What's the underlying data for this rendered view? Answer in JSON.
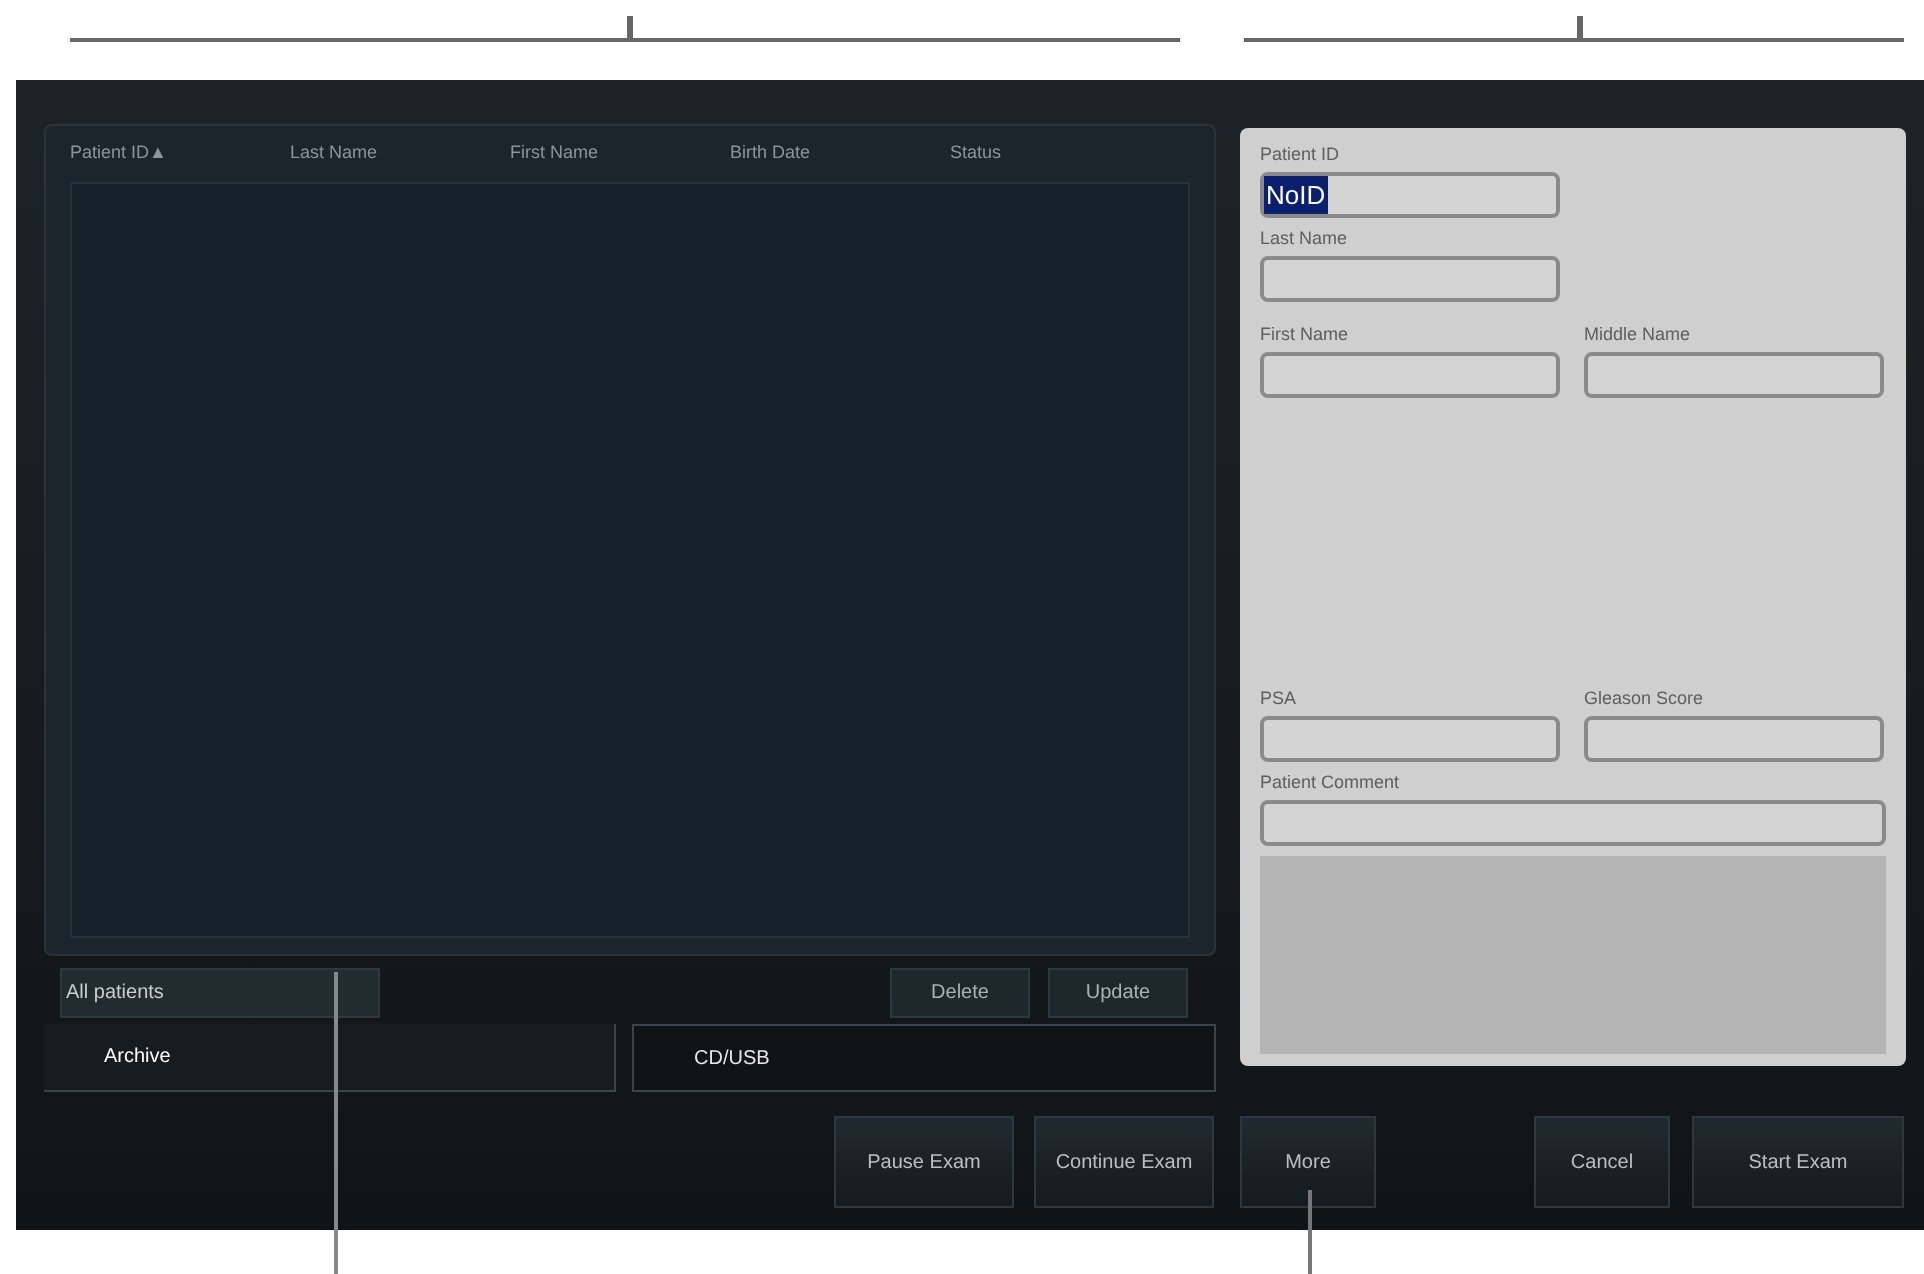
{
  "table": {
    "columns": [
      {
        "label": "Patient ID▲"
      },
      {
        "label": "Last Name"
      },
      {
        "label": "First Name"
      },
      {
        "label": "Birth Date"
      },
      {
        "label": "Status"
      }
    ]
  },
  "filter": {
    "value": "All patients"
  },
  "list_buttons": [
    "Delete",
    "Update"
  ],
  "tabs": [
    {
      "label": "Archive",
      "selected": true
    },
    {
      "label": "CD/USB",
      "selected": false
    }
  ],
  "form": {
    "rows": [
      {
        "fields": [
          {
            "label": "Patient ID",
            "value": "NoID",
            "text_selected": true,
            "kind": "half"
          }
        ]
      },
      {
        "fields": [
          {
            "label": "Last Name",
            "kind": "half"
          }
        ]
      },
      {
        "fields": [
          {
            "label": "First Name",
            "kind": "half"
          },
          {
            "label": "Middle Name",
            "kind": "half"
          }
        ]
      },
      {
        "fields": [
          {
            "label": "PSA",
            "kind": "half"
          },
          {
            "label": "Gleason Score",
            "kind": "half"
          }
        ]
      },
      {
        "fields": [
          {
            "label": "Patient Comment",
            "kind": "full"
          }
        ]
      }
    ]
  },
  "actions": [
    "Pause Exam",
    "Continue Exam",
    "More",
    "Cancel",
    "Start Exam"
  ]
}
